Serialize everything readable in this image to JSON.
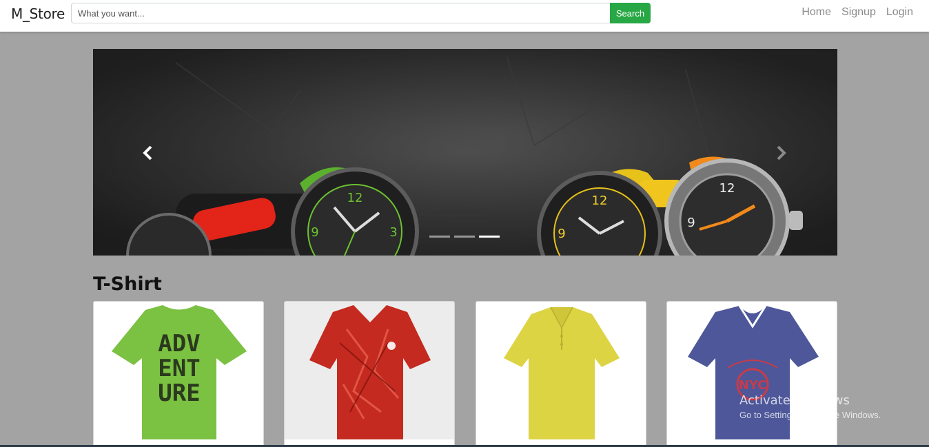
{
  "navbar": {
    "brand": "M_Store",
    "search": {
      "placeholder": "What you want...",
      "value": "",
      "button_label": "Search"
    },
    "links": [
      "Home",
      "Signup",
      "Login"
    ]
  },
  "carousel": {
    "slide_count": 3,
    "active_index": 2,
    "image": "watches-banner",
    "prev_icon": "chevron-left-icon",
    "next_icon": "chevron-right-icon"
  },
  "section": {
    "title": "T-Shirt",
    "products": [
      {
        "name": "green-adventure-tshirt",
        "print": [
          "ADV",
          "ENT",
          "URE"
        ],
        "color": "#7bc142"
      },
      {
        "name": "red-pattern-tshirt",
        "color": "#c42a1f"
      },
      {
        "name": "yellow-polo-shirt",
        "color": "#dcd443"
      },
      {
        "name": "navy-v-neck-tshirt",
        "color": "#4d5799"
      }
    ]
  },
  "watermark": {
    "title": "Activate Windows",
    "subtitle": "Go to Settings to activate Windows."
  },
  "colors": {
    "navbar_bg": "#ffffff",
    "page_bg": "#a3a3a3",
    "search_button": "#28a745",
    "nav_link": "#8a8a8a"
  }
}
